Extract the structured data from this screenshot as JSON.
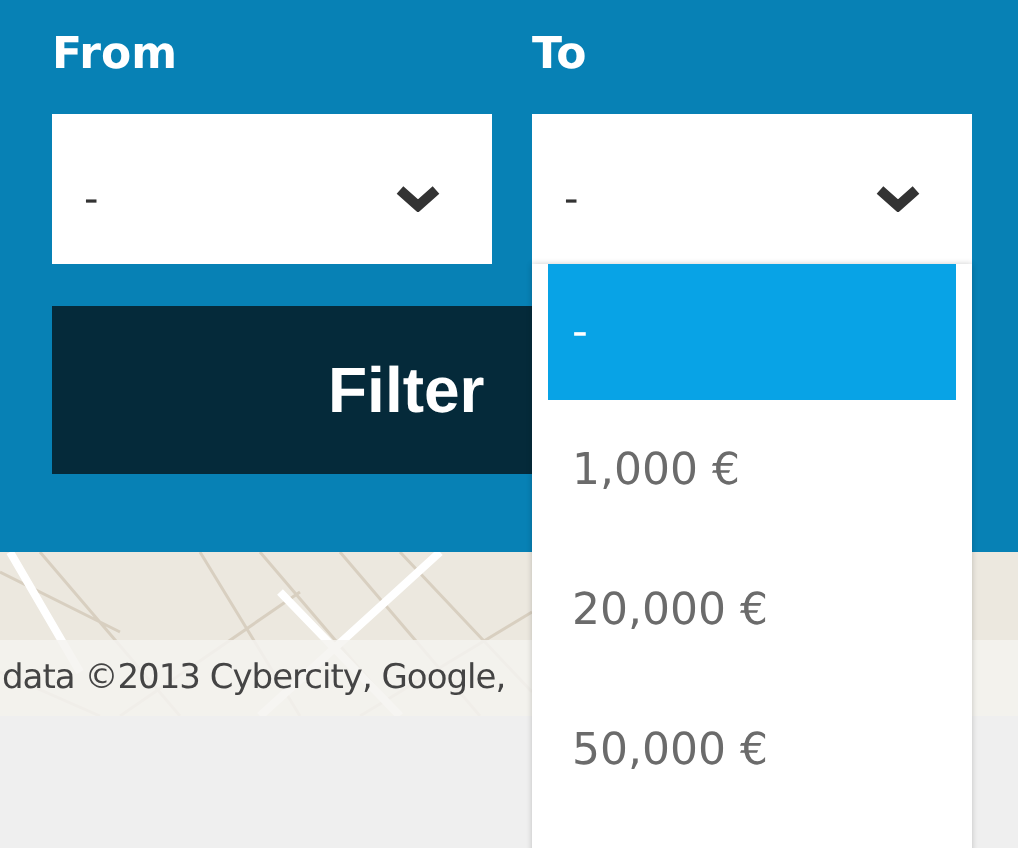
{
  "filters": [
    {
      "label": "From",
      "value": "-"
    },
    {
      "label": "To",
      "value": "-"
    }
  ],
  "filter_button": {
    "label": "Filter"
  },
  "map": {
    "attribution": "data ©2013 Cybercity, Google,"
  },
  "dropdown": {
    "options": [
      {
        "label": "-",
        "selected": true
      },
      {
        "label": "1,000 €",
        "selected": false
      },
      {
        "label": "20,000 €",
        "selected": false
      },
      {
        "label": "50,000 €",
        "selected": false
      }
    ]
  }
}
